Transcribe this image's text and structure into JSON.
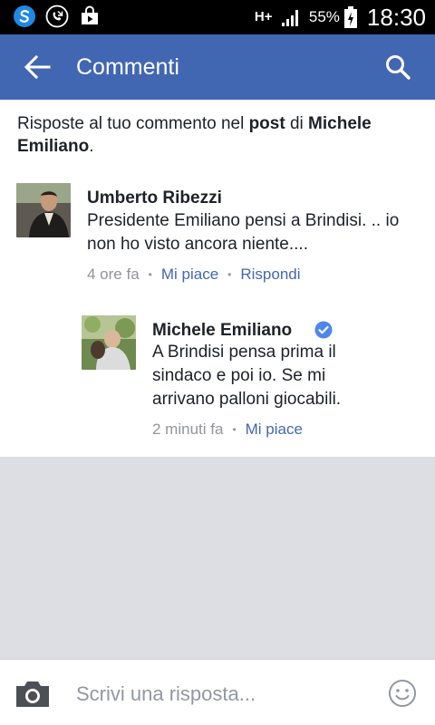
{
  "status_bar": {
    "network": "H+",
    "battery_percent": "55%",
    "time": "18:30"
  },
  "app_bar": {
    "title": "Commenti"
  },
  "intro": {
    "prefix": "Risposte al tuo commento nel ",
    "post_word": "post",
    "middle": " di ",
    "author": "Michele Emiliano",
    "suffix": "."
  },
  "comments": [
    {
      "author": "Umberto Ribezzi",
      "text": "Presidente Emiliano pensi a Brindisi. .. io non ho visto ancora niente....",
      "time": "4 ore fa",
      "like_label": "Mi piace",
      "reply_label": "Rispondi"
    },
    {
      "author": "Michele Emiliano",
      "text": "A Brindisi pensa prima il sindaco e poi io. Se mi arrivano palloni giocabili.",
      "time": "2 minuti fa",
      "like_label": "Mi piace",
      "verified": true
    }
  ],
  "composer": {
    "placeholder": "Scrivi una risposta..."
  },
  "colors": {
    "brand_blue": "#4267b2",
    "verified_blue": "#4f86ec",
    "meta_gray": "#90949c",
    "background_gray": "#dcdee3"
  },
  "icons": [
    "s-app-icon",
    "phone-icon",
    "play-store-icon",
    "signal-icon",
    "battery-icon",
    "back-arrow-icon",
    "search-icon",
    "verified-icon",
    "camera-icon",
    "emoji-icon"
  ]
}
